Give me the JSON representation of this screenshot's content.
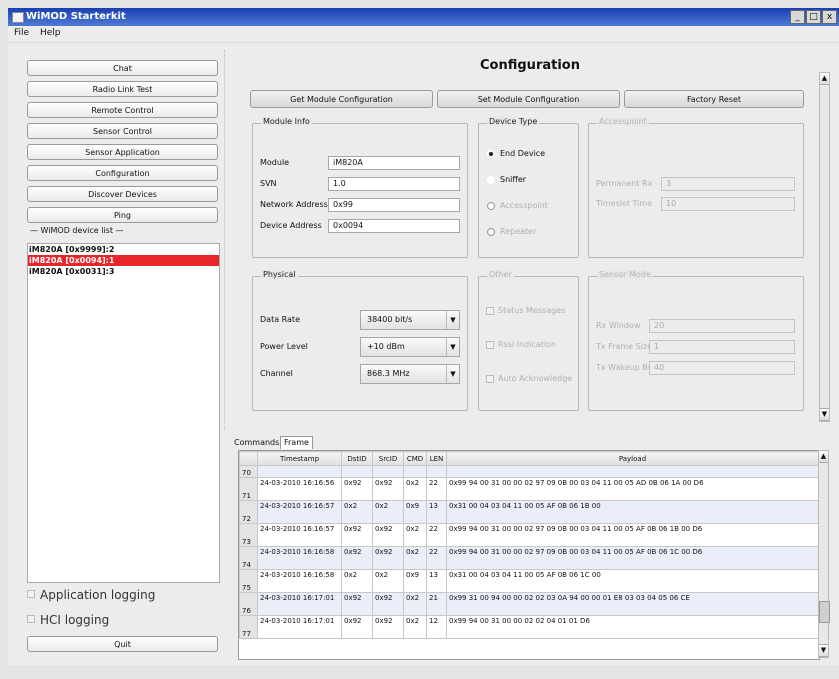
{
  "window": {
    "title": "WiMOD Starterkit",
    "buttons": [
      "_",
      "□",
      "x"
    ]
  },
  "menu": [
    "File",
    "Help"
  ],
  "nav_buttons": [
    "Chat",
    "Radio Link Test",
    "Remote Control",
    "Sensor Control",
    "Sensor Application",
    "Configuration",
    "Discover Devices",
    "Ping"
  ],
  "device_list": {
    "label": "WiMOD device list",
    "items": [
      "iM820A [0x9999]:2",
      "iM820A [0x0094]:1",
      "iM820A [0x0031]:3"
    ],
    "selected_index": 1
  },
  "logging": {
    "app": "Application logging",
    "hci": "HCI logging"
  },
  "quit_label": "Quit",
  "config": {
    "title": "Configuration",
    "actions": [
      "Get Module Configuration",
      "Set Module Configuration",
      "Factory Reset"
    ],
    "module_info": {
      "label": "Module Info",
      "fields": [
        {
          "label": "Module",
          "value": "iM820A"
        },
        {
          "label": "SVN",
          "value": "1.0"
        },
        {
          "label": "Network Address",
          "value": "0x99"
        },
        {
          "label": "Device Address",
          "value": "0x0094"
        }
      ]
    },
    "device_type": {
      "label": "Device Type",
      "options": [
        "End Device",
        "Sniffer",
        "Accesspoint",
        "Repeater"
      ],
      "selected": 0
    },
    "accesspoint": {
      "label": "Accesspoint",
      "fields": [
        {
          "label": "Permanent Rx",
          "value": "3"
        },
        {
          "label": "Timeslot Time",
          "value": "10"
        }
      ]
    },
    "physical": {
      "label": "Physical",
      "fields": [
        {
          "label": "Data Rate",
          "value": "38400 bit/s"
        },
        {
          "label": "Power Level",
          "value": "+10 dBm"
        },
        {
          "label": "Channel",
          "value": "868.3 MHz"
        }
      ]
    },
    "other": {
      "label": "Other",
      "checks": [
        "Status Messages",
        "Rssi Indication",
        "Auto Acknowledge"
      ]
    },
    "sensor_mode": {
      "label": "Sensor Mode",
      "fields": [
        {
          "label": "Rx Window",
          "value": "20"
        },
        {
          "label": "Tx Frame Size",
          "value": "1"
        },
        {
          "label": "Tx Wakeup Burst",
          "value": "40"
        }
      ]
    }
  },
  "tabs": [
    "Commands",
    "Frame"
  ],
  "active_tab": 1,
  "frame_table": {
    "columns": [
      "Timestamp",
      "DstID",
      "SrcID",
      "CMD",
      "LEN",
      "Payload"
    ],
    "rows": [
      {
        "n": "70",
        "ts": "",
        "dst": "",
        "src": "",
        "cmd": "",
        "len": "",
        "payload": ""
      },
      {
        "n": "71",
        "ts": "24-03-2010 16:16:56",
        "dst": "0x92",
        "src": "0x92",
        "cmd": "0x2",
        "len": "22",
        "payload": "0x99 94 00 31 00 00 02 97 09 0B 00 03 04 11 00 05 AD 0B 06 1A 00 D6"
      },
      {
        "n": "72",
        "ts": "24-03-2010 16:16:57",
        "dst": "0x2",
        "src": "0x2",
        "cmd": "0x9",
        "len": "13",
        "payload": "0x31 00 04 03 04 11 00 05 AF 0B 06 1B 00"
      },
      {
        "n": "73",
        "ts": "24-03-2010 16:16:57",
        "dst": "0x92",
        "src": "0x92",
        "cmd": "0x2",
        "len": "22",
        "payload": "0x99 94 00 31 00 00 02 97 09 0B 00 03 04 11 00 05 AF 0B 06 1B 00 D6"
      },
      {
        "n": "74",
        "ts": "24-03-2010 16:16:58",
        "dst": "0x92",
        "src": "0x92",
        "cmd": "0x2",
        "len": "22",
        "payload": "0x99 94 00 31 00 00 02 97 09 0B 00 03 04 11 00 05 AF 0B 06 1C 00 D6"
      },
      {
        "n": "75",
        "ts": "24-03-2010 16:16:58",
        "dst": "0x2",
        "src": "0x2",
        "cmd": "0x9",
        "len": "13",
        "payload": "0x31 00 04 03 04 11 00 05 AF 0B 06 1C 00"
      },
      {
        "n": "76",
        "ts": "24-03-2010 16:17:01",
        "dst": "0x92",
        "src": "0x92",
        "cmd": "0x2",
        "len": "21",
        "payload": "0x99 31 00 94 00 00 02 02 03 0A 94 00 00 01 E8 03 03 04 05 06 CE"
      },
      {
        "n": "77",
        "ts": "24-03-2010 16:17:01",
        "dst": "0x92",
        "src": "0x92",
        "cmd": "0x2",
        "len": "12",
        "payload": "0x99 94 00 31 00 00 02 02 04 01 01 D6"
      }
    ]
  },
  "colors": {
    "titlebar": "#2448b8",
    "selected_row": "#e8252b",
    "alt_row": "#e9eef8"
  }
}
